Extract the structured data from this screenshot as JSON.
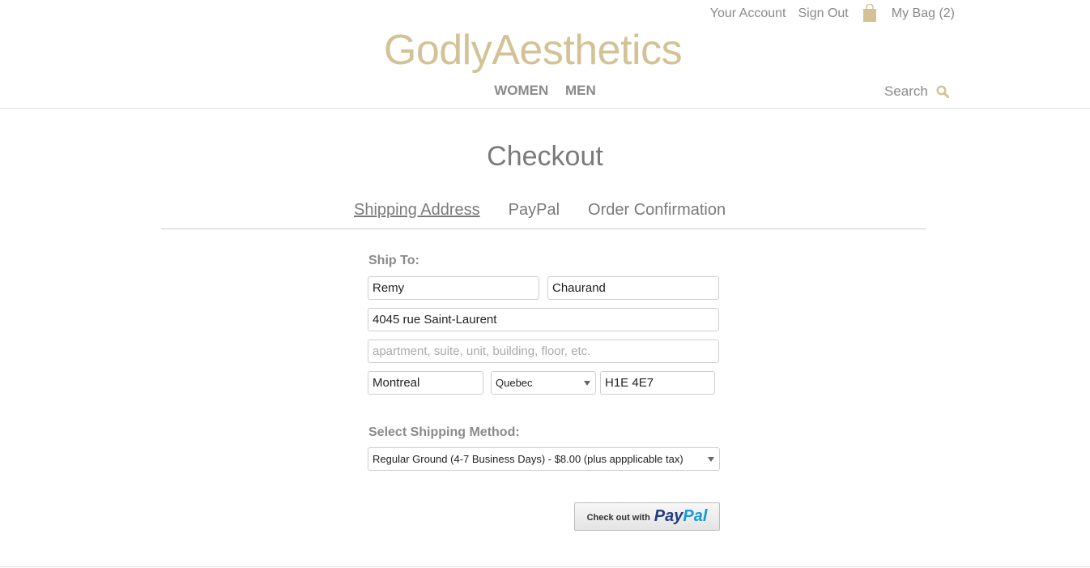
{
  "header": {
    "your_account": "Your Account",
    "sign_out": "Sign Out",
    "bag": "My Bag (2)",
    "logo": "GodlyAesthetics",
    "nav": [
      "WOMEN",
      "MEN"
    ],
    "search": "Search"
  },
  "page": {
    "title": "Checkout"
  },
  "steps": [
    "Shipping Address",
    "PayPal",
    "Order Confirmation"
  ],
  "shipping": {
    "ship_to_label": "Ship To:",
    "first_name": "Remy",
    "last_name": "Chaurand",
    "address1": "4045 rue Saint-Laurent",
    "address2_placeholder": "apartment, suite, unit, building, floor, etc.",
    "city": "Montreal",
    "province": "Quebec",
    "postal": "H1E 4E7",
    "method_label": "Select Shipping Method:",
    "method_selected": "Regular Ground (4-7 Business Days) - $8.00 (plus appplicable tax)"
  },
  "paypal_button": {
    "prefix": "Check out with",
    "pay": "Pay",
    "pal": "Pal"
  },
  "colors": {
    "brand": "#d2c295",
    "text_gray": "#8a8a8a",
    "paypal_dark": "#253b80",
    "paypal_light": "#179bd7"
  },
  "icons": {
    "bag": "shopping-bag-icon",
    "search": "search-icon"
  }
}
